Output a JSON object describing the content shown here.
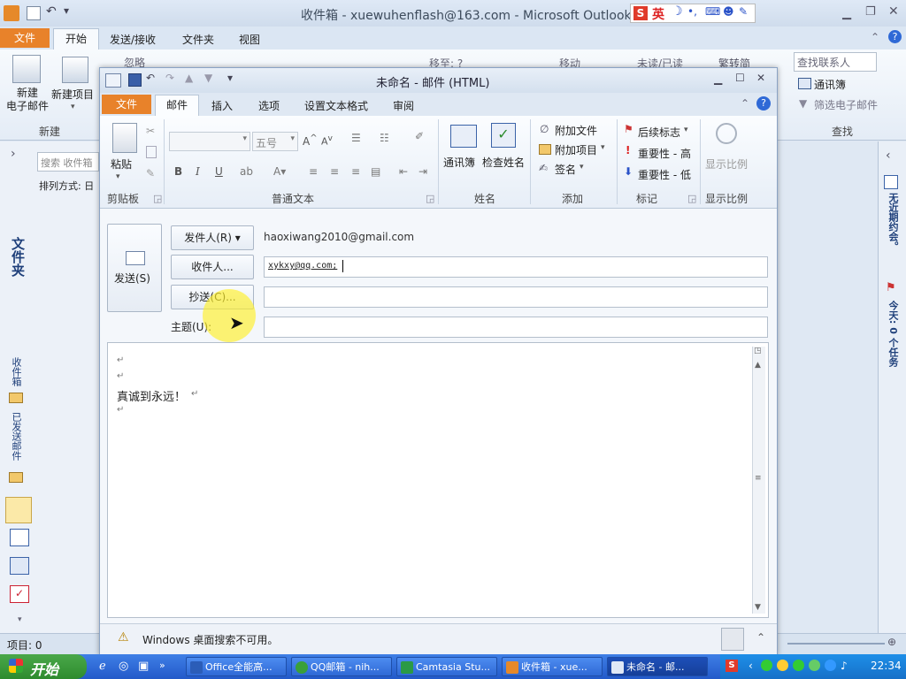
{
  "main_window": {
    "title": "收件箱 - xuewuhenflash@163.com  -  Microsoft Outlook",
    "tabs": [
      "文件",
      "开始",
      "发送/接收",
      "文件夹",
      "视图"
    ],
    "ribbon": {
      "new_email": "新建\n电子邮件",
      "new_item": "新建项目",
      "group_new": "新建",
      "ignore": "忽略",
      "move_to": "移至: ?",
      "move": "移动",
      "unread_read": "未读/已读",
      "trad_simp": "繁转简",
      "find_contact_placeholder": "查找联系人",
      "address_book": "通讯簿",
      "filter_email": "筛选电子邮件",
      "group_find": "查找"
    },
    "left_pane": {
      "search_placeholder": "搜索 收件箱",
      "sort_by": "排列方式: 日",
      "folders_label": "文件夹",
      "inbox": "收件箱",
      "sent": "已发送邮件"
    },
    "right_pane": {
      "no_appointments": "无近期约会。",
      "today_tasks": "今天: 0 个任务"
    },
    "status": "项目: 0",
    "ime": "英"
  },
  "compose": {
    "title": "未命名 - 邮件 (HTML)",
    "tabs": [
      "文件",
      "邮件",
      "插入",
      "选项",
      "设置文本格式",
      "审阅"
    ],
    "ribbon": {
      "paste": "粘贴",
      "group_clipboard": "剪贴板",
      "font_size": "五号",
      "group_basic_text": "普通文本",
      "address_book": "通讯簿",
      "check_names": "检查姓名",
      "group_names": "姓名",
      "attach_file": "附加文件",
      "attach_item": "附加项目",
      "signature": "签名",
      "group_include": "添加",
      "follow_up": "后续标志",
      "high_importance": "重要性 - 高",
      "low_importance": "重要性 - 低",
      "group_tags": "标记",
      "zoom": "显示比例",
      "group_zoom": "显示比例"
    },
    "send_button": "发送(S)",
    "from_button": "发件人(R) ▾",
    "from_address": "haoxiwang2010@gmail.com",
    "to_button": "收件人...",
    "to_value": "xykxy@qq.com;",
    "cc_button": "抄送(C)...",
    "cc_value": "",
    "subject_label": "主题(U):",
    "subject_value": "",
    "body_line": "真诚到永远！",
    "info_bar": "Windows 桌面搜索不可用。"
  },
  "taskbar": {
    "start": "开始",
    "items": [
      "Office全能高...",
      "QQ邮箱 - nih...",
      "Camtasia Stu...",
      "收件箱 - xue...",
      "未命名 - 邮..."
    ],
    "clock": "22:34"
  }
}
